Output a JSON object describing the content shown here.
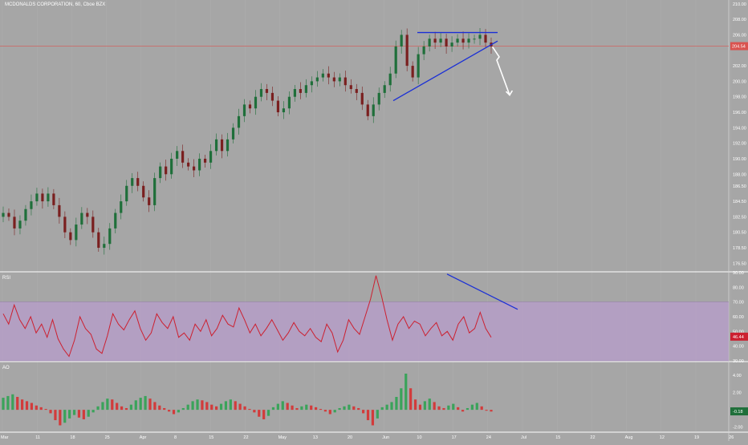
{
  "header": {
    "symbol_line": "MCDONALDS CORPORATION, 60, Cboe BZX"
  },
  "colors": {
    "background": "#a6a6a6",
    "up_candle": "#1f6f3a",
    "down_candle": "#7a1f1f",
    "price_line": "#d9534f",
    "trend_line": "#1a2fd6",
    "arrow": "#ffffff",
    "rsi_line": "#cc2030",
    "rsi_band": "#b79ccb",
    "ao_up": "#3aa35a",
    "ao_down": "#d23b3b",
    "grid": "#b3b3b3",
    "separator": "#ffffff"
  },
  "chart_data": [
    {
      "type": "candlestick",
      "panel": "price",
      "title": "MCDONALDS CORPORATION, 60, Cboe BZX",
      "ylim": [
        175.5,
        210.5
      ],
      "y_ticks": [
        "210.00",
        "208.00",
        "206.00",
        "204.54",
        "202.00",
        "200.00",
        "198.00",
        "196.00",
        "194.00",
        "192.00",
        "190.00",
        "188.00",
        "186.50",
        "184.50",
        "182.50",
        "180.50",
        "178.50",
        "176.50"
      ],
      "last_price": "204.54",
      "x_ticks": [
        "Mar",
        "11",
        "18",
        "25",
        "Apr",
        "8",
        "15",
        "22",
        "May",
        "13",
        "20",
        "Jun",
        "10",
        "17",
        "24",
        "Jul",
        "15",
        "22",
        "Aug",
        "12",
        "19",
        "26"
      ],
      "series_close": [
        183,
        182.5,
        181,
        182,
        183.5,
        184.5,
        185.5,
        184.5,
        185.5,
        184,
        182.5,
        180.5,
        179.5,
        181.5,
        183,
        182.5,
        180.5,
        178.5,
        179,
        181,
        183,
        184.5,
        186.5,
        187.5,
        186.5,
        185,
        184,
        187.5,
        189,
        188,
        190,
        191,
        189.5,
        189,
        188.5,
        190,
        189.5,
        191,
        192.5,
        191,
        192.5,
        194,
        195.5,
        197,
        196.5,
        198,
        199,
        198.5,
        197.5,
        196,
        196.5,
        198,
        199,
        198.5,
        199.5,
        200,
        200.5,
        201,
        200.5,
        200,
        200.5,
        199.5,
        199,
        198.5,
        197,
        195.5,
        197,
        198.5,
        199.5,
        201,
        204.5,
        206,
        202,
        200.5,
        203.5,
        204.5,
        205.5,
        205,
        205.5,
        204.5,
        205,
        205.5,
        205,
        205.5,
        205.5,
        206,
        205,
        204.5
      ],
      "annotations": [
        {
          "type": "resistance_line",
          "from": [
            0.52,
            206.3
          ],
          "to": [
            0.62,
            206.3
          ]
        },
        {
          "type": "support_trendline",
          "from": [
            0.49,
            197.5
          ],
          "to": [
            0.62,
            205.2
          ]
        },
        {
          "type": "down_arrow",
          "from": [
            0.62,
            204.6
          ],
          "to": [
            0.63,
            200.5
          ]
        }
      ]
    },
    {
      "type": "line",
      "panel": "rsi",
      "title": "RSI",
      "ylim": [
        30,
        90
      ],
      "y_ticks": [
        "90.00",
        "80.00",
        "70.00",
        "60.00",
        "50.00",
        "40.00",
        "30.00"
      ],
      "band": [
        30,
        70
      ],
      "last_value": "46.44",
      "values": [
        62,
        55,
        68,
        58,
        52,
        60,
        49,
        55,
        46,
        58,
        45,
        38,
        33,
        44,
        60,
        52,
        48,
        38,
        35,
        47,
        62,
        55,
        51,
        58,
        64,
        52,
        44,
        49,
        62,
        56,
        52,
        60,
        46,
        49,
        44,
        55,
        50,
        58,
        47,
        52,
        61,
        55,
        53,
        66,
        58,
        49,
        55,
        47,
        52,
        58,
        51,
        44,
        49,
        56,
        50,
        47,
        52,
        46,
        43,
        55,
        49,
        36,
        44,
        58,
        52,
        48,
        60,
        72,
        88,
        74,
        58,
        44,
        55,
        60,
        52,
        57,
        55,
        47,
        52,
        56,
        47,
        50,
        44,
        55,
        60,
        49,
        52,
        63,
        52,
        46
      ],
      "annotations": [
        {
          "type": "divergence_line",
          "from": [
            0.557,
            89
          ],
          "to": [
            0.645,
            65
          ]
        }
      ]
    },
    {
      "type": "bar",
      "panel": "ao",
      "title": "AO",
      "ylim": [
        -2.5,
        5.5
      ],
      "y_ticks": [
        "4.00",
        "2.00",
        "0.00",
        "-2.00"
      ],
      "last_value": "-0.18",
      "values": [
        1.4,
        1.6,
        1.8,
        1.5,
        1.2,
        1.0,
        0.8,
        0.5,
        0.3,
        0.1,
        -0.4,
        -1.2,
        -1.8,
        -1.5,
        -1.0,
        -0.6,
        -0.9,
        -1.1,
        -0.8,
        -0.3,
        0.4,
        0.9,
        1.3,
        1.2,
        0.8,
        0.4,
        0.2,
        0.6,
        1.1,
        1.4,
        1.6,
        1.3,
        0.9,
        0.5,
        0.2,
        -0.2,
        -0.5,
        -0.3,
        0.2,
        0.6,
        1.0,
        1.2,
        1.1,
        0.9,
        0.6,
        0.4,
        0.7,
        1.0,
        1.2,
        1.0,
        0.7,
        0.4,
        0.1,
        -0.3,
        -0.8,
        -1.1,
        -0.7,
        0.3,
        0.7,
        1.0,
        0.8,
        0.5,
        0.2,
        0.4,
        0.6,
        0.5,
        0.3,
        0.1,
        -0.2,
        -0.5,
        -0.3,
        0.2,
        0.4,
        0.6,
        0.4,
        0.2,
        -0.4,
        -1.2,
        -1.8,
        -1.0,
        0.3,
        0.6,
        0.9,
        1.5,
        2.5,
        4.2,
        2.5,
        1.2,
        0.6,
        1.0,
        1.3,
        0.9,
        0.4,
        0.2,
        0.5,
        0.7,
        0.3,
        -0.2,
        0.2,
        0.6,
        0.8,
        0.4,
        -0.1,
        -0.2
      ]
    }
  ]
}
